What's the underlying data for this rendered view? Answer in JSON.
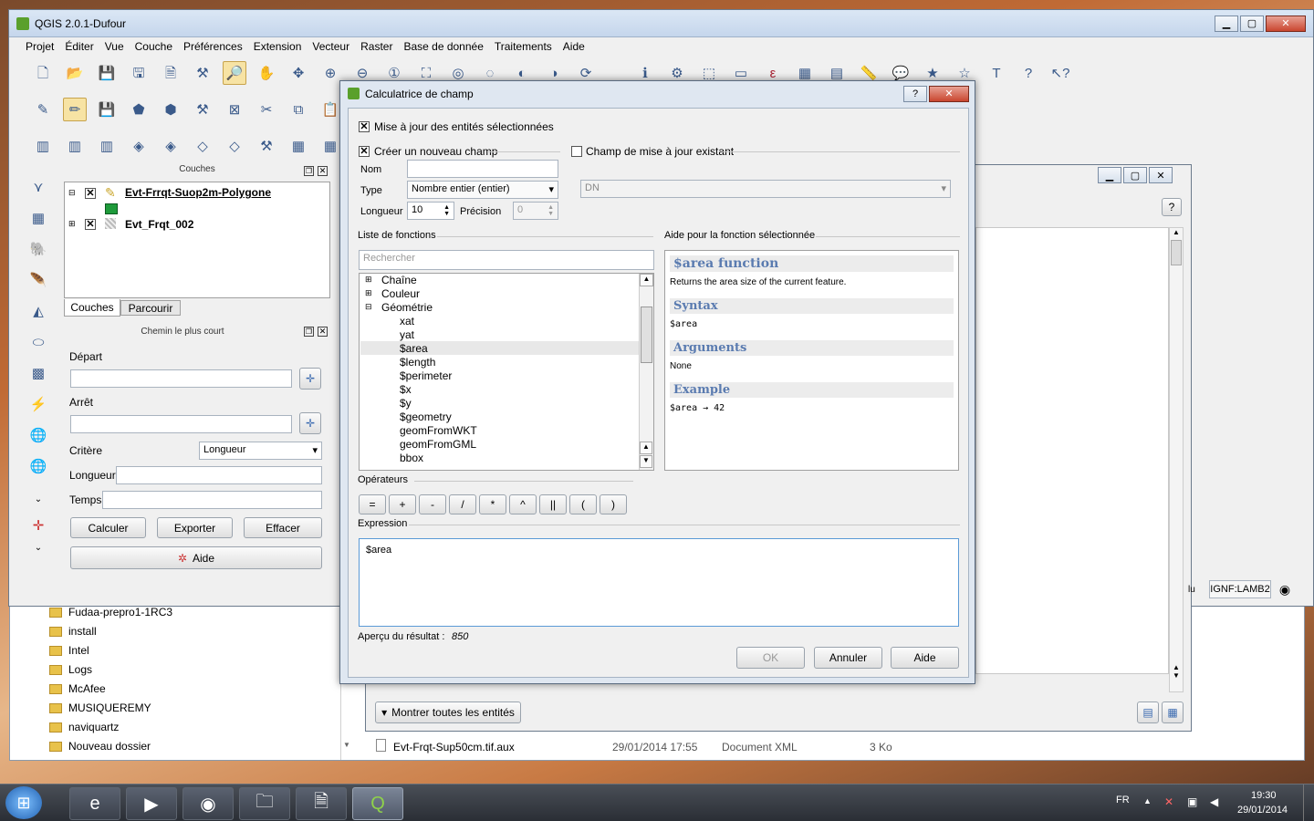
{
  "qgis": {
    "title": "QGIS 2.0.1-Dufour",
    "menu": [
      "Projet",
      "Éditer",
      "Vue",
      "Couche",
      "Préférences",
      "Extension",
      "Vecteur",
      "Raster",
      "Base de donnée",
      "Traitements",
      "Aide"
    ]
  },
  "layers_panel": {
    "title": "Couches",
    "layers": [
      "Evt-Frrqt-Suop2m-Polygone",
      "Evt_Frqt_002"
    ],
    "tabs": [
      "Couches",
      "Parcourir"
    ]
  },
  "route_panel": {
    "title": "Chemin le plus court",
    "depart_label": "Départ",
    "arret_label": "Arrêt",
    "critere_label": "Critère",
    "critere_value": "Longueur",
    "longueur_label": "Longueur",
    "temps_label": "Temps",
    "calc_button": "Calculer",
    "export_button": "Exporter",
    "clear_button": "Effacer",
    "help_button": "Aide"
  },
  "dialog": {
    "title": "Calculatrice de champ",
    "update_selected": "Mise à jour des entités sélectionnées",
    "create_new": "Créer un nouveau champ",
    "update_existing": "Champ de mise à jour existant",
    "nom_label": "Nom",
    "type_label": "Type",
    "type_value": "Nombre entier (entier)",
    "existing_field": "DN",
    "longueur_label": "Longueur",
    "longueur_value": "10",
    "precision_label": "Précision",
    "precision_value": "0",
    "functions_label": "Liste de fonctions",
    "search_placeholder": "Rechercher",
    "tree_groups": [
      "Chaîne",
      "Couleur",
      "Géométrie"
    ],
    "tree_items": [
      "xat",
      "yat",
      "$area",
      "$length",
      "$perimeter",
      "$x",
      "$y",
      "$geometry",
      "geomFromWKT",
      "geomFromGML",
      "bbox"
    ],
    "help_label": "Aide pour la fonction sélectionnée",
    "help": {
      "heading": "$area function",
      "desc": "Returns the area size of the current feature.",
      "syntax_h": "Syntax",
      "syntax": "$area",
      "args_h": "Arguments",
      "args": "None",
      "example_h": "Example",
      "example": "$area → 42"
    },
    "operators_label": "Opérateurs",
    "operators": [
      "=",
      "+",
      "-",
      "/",
      "*",
      "^",
      "||",
      "(",
      ")"
    ],
    "expression_label": "Expression",
    "expression": "$area",
    "preview_label": "Aperçu du résultat :",
    "preview_value": "850",
    "ok_button": "OK",
    "cancel_button": "Annuler",
    "help_button": "Aide"
  },
  "attr_window": {
    "show_all": "Montrer toutes les entités",
    "crs": "IGNF:LAMB2",
    "partial_label": "lu"
  },
  "explorer": {
    "folders": [
      "Fudaa-prepro1-1RC3",
      "install",
      "Intel",
      "Logs",
      "McAfee",
      "MUSIQUEREMY",
      "naviquartz",
      "Nouveau dossier"
    ],
    "file": {
      "name": "Evt-Frqt-Sup50cm.tif.aux",
      "date": "29/01/2014 17:55",
      "type": "Document XML",
      "size": "3 Ko"
    }
  },
  "taskbar": {
    "lang": "FR",
    "time": "19:30",
    "date": "29/01/2014"
  }
}
